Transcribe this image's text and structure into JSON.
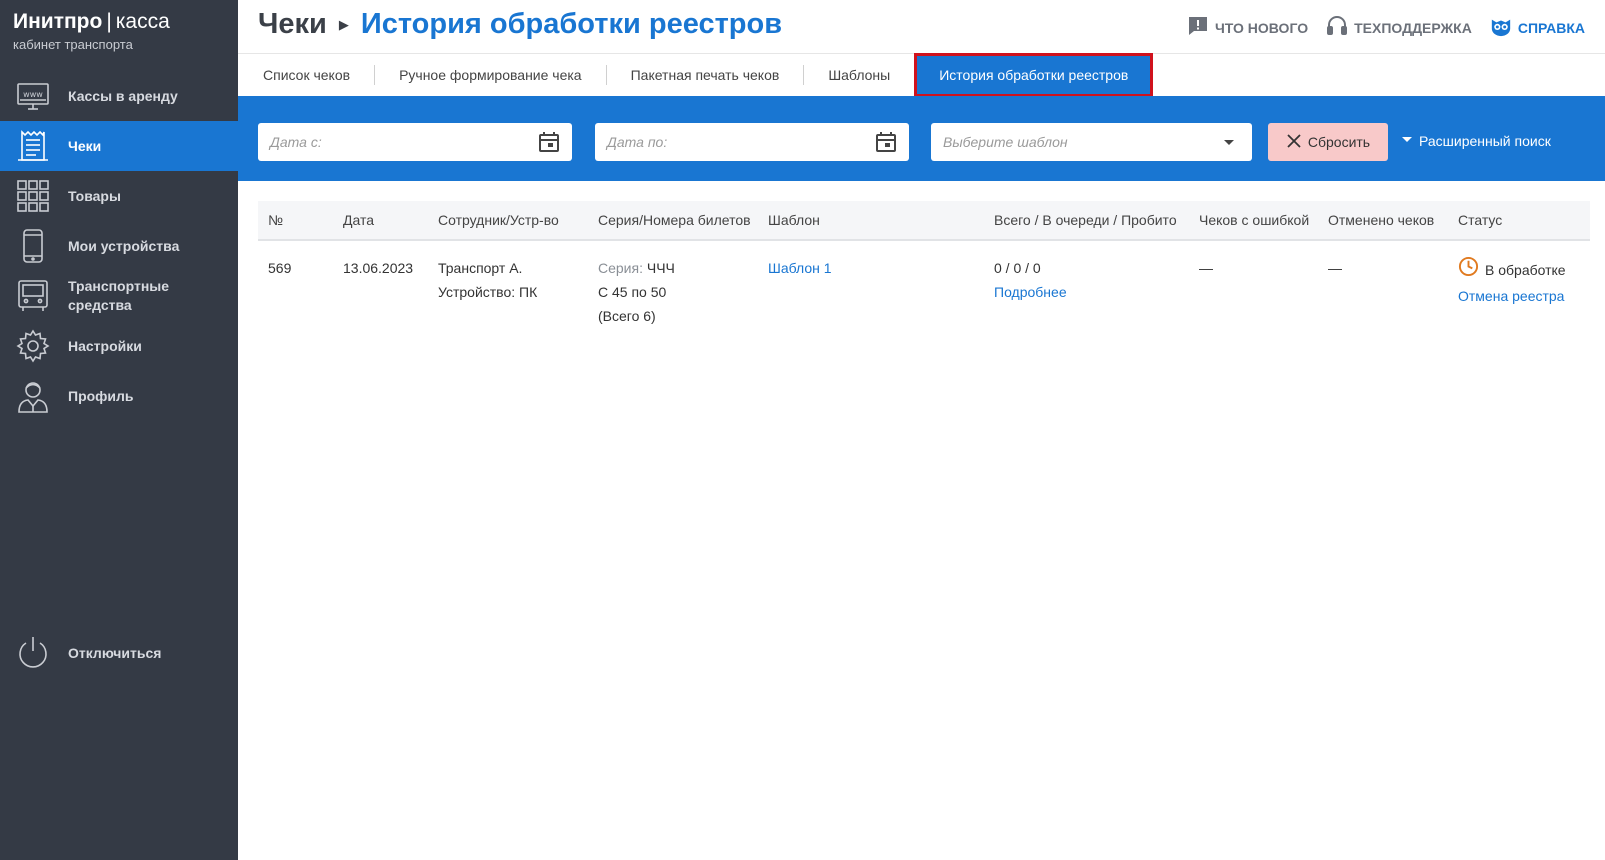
{
  "sidebar": {
    "brand_name": "Инитпро",
    "brand_sep": "|",
    "brand_product": "касса",
    "brand_subtitle": "кабинет транспорта",
    "items": [
      {
        "label": "Кассы в аренду",
        "icon": "www-monitor-icon"
      },
      {
        "label": "Чеки",
        "icon": "receipt-icon"
      },
      {
        "label": "Товары",
        "icon": "grid-icon"
      },
      {
        "label": "Мои устройства",
        "icon": "smartphone-icon"
      },
      {
        "label": "Транспортные средства",
        "icon": "bus-icon"
      },
      {
        "label": "Настройки",
        "icon": "gear-icon"
      },
      {
        "label": "Профиль",
        "icon": "user-icon"
      }
    ],
    "logout_label": "Отключиться",
    "active_color": "#1976d2",
    "bg_color": "#343a45"
  },
  "header": {
    "crumb_root": "Чеки",
    "crumb_current": "История обработки реестров",
    "links": {
      "whats_new": "ЧТО НОВОГО",
      "support": "ТЕХПОДДЕРЖКА",
      "help": "СПРАВКА"
    }
  },
  "tabs": [
    {
      "label": "Список чеков"
    },
    {
      "label": "Ручное формирование чека"
    },
    {
      "label": "Пакетная печать чеков"
    },
    {
      "label": "Шаблоны"
    },
    {
      "label": "История обработки реестров",
      "active": true
    }
  ],
  "filters": {
    "date_from_placeholder": "Дата с:",
    "date_to_placeholder": "Дата по:",
    "template_placeholder": "Выберите шаблон",
    "reset_label": "Сбросить",
    "advanced_label": "Расширенный поиск"
  },
  "table": {
    "headers": {
      "num": "№",
      "date": "Дата",
      "employee": "Сотрудник/Устр-во",
      "series": "Серия/Номера билетов",
      "template": "Шаблон",
      "totals": "Всего / В очереди / Пробито",
      "errors": "Чеков с ошибкой",
      "cancelled": "Отменено чеков",
      "status": "Статус"
    },
    "rows": [
      {
        "num": "569",
        "date": "13.06.2023",
        "employee": "Транспорт А.",
        "device": "Устройство: ПК",
        "series_label": "Серия:",
        "series_value": "ЧЧЧ",
        "range": "С 45 по 50",
        "total": "(Всего 6)",
        "template": "Шаблон 1",
        "totals": "0 / 0 / 0",
        "details_link": "Подробнее",
        "errors": "—",
        "cancelled": "—",
        "status": "В обработке",
        "cancel_link": "Отмена реестра"
      }
    ]
  }
}
